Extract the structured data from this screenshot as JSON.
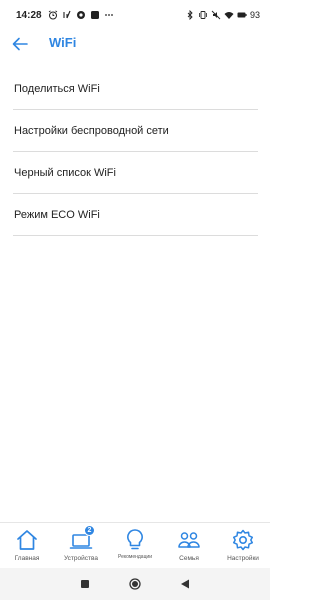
{
  "status_bar": {
    "time": "14:28",
    "battery": "93"
  },
  "header": {
    "title": "WiFi"
  },
  "menu": {
    "items": [
      {
        "label": "Поделиться WiFi"
      },
      {
        "label": "Настройки беспроводной сети"
      },
      {
        "label": "Черный список WiFi"
      },
      {
        "label": "Режим ECO WiFi"
      }
    ]
  },
  "tabbar": {
    "items": [
      {
        "label": "Главная",
        "icon": "home-icon"
      },
      {
        "label": "Устройства",
        "icon": "devices-icon",
        "badge": "2"
      },
      {
        "label": "Рекомендации",
        "icon": "lightbulb-icon"
      },
      {
        "label": "Семья",
        "icon": "family-icon"
      },
      {
        "label": "Настройки",
        "icon": "gear-icon"
      }
    ]
  },
  "colors": {
    "accent": "#2f86e2",
    "text": "#222222",
    "divider": "#dcdcdc"
  }
}
